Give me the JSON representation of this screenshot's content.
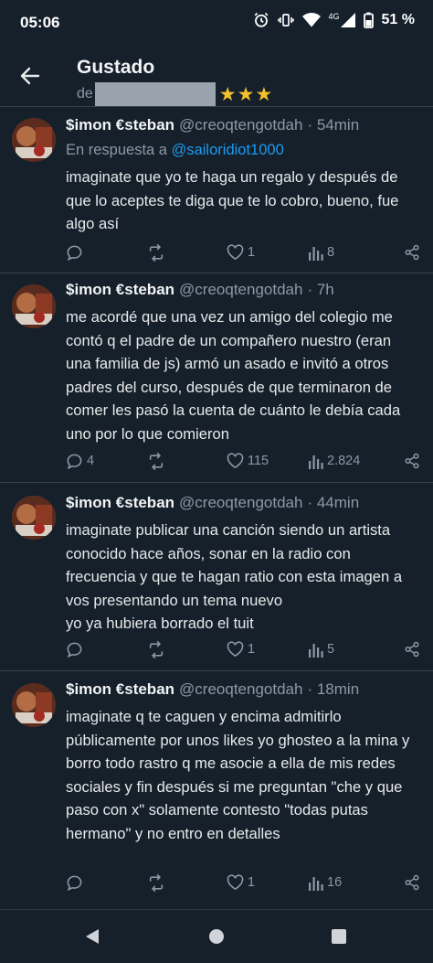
{
  "status": {
    "time": "05:06",
    "network": "4G",
    "battery": "51 %"
  },
  "header": {
    "title": "Gustado",
    "subtitle_prefix": "de",
    "stars": "★★★"
  },
  "tweets": [
    {
      "name": "$imon €steban",
      "handle": "@creoqtengotdah",
      "time": "· 54min",
      "reply_prefix": "En respuesta a",
      "reply_handle": "@sailoridiot1000",
      "text": "imaginate que yo te haga un regalo y después de que lo aceptes te diga que te lo cobro, bueno, fue algo así",
      "replies": "",
      "retweets": "",
      "likes": "1",
      "views": "8"
    },
    {
      "name": "$imon €steban",
      "handle": "@creoqtengotdah",
      "time": "· 7h",
      "text": "me acordé que una vez un amigo del colegio me contó q el padre de un compañero nuestro (eran una familia de js) armó un asado e invitó a otros padres del curso, después de que terminaron de comer les pasó la cuenta de cuánto le debía cada uno por lo que comieron",
      "replies": "4",
      "retweets": "",
      "likes": "115",
      "views": "2.824"
    },
    {
      "name": "$imon €steban",
      "handle": "@creoqtengotdah",
      "time": "· 44min",
      "text": "imaginate publicar una canción siendo un artista conocido hace años, sonar en la radio con frecuencia y que te hagan ratio con esta imagen a vos presentando un tema nuevo\nyo ya hubiera borrado el tuit",
      "replies": "",
      "retweets": "",
      "likes": "1",
      "views": "5"
    },
    {
      "name": "$imon €steban",
      "handle": "@creoqtengotdah",
      "time": "· 18min",
      "text": "imaginate q te caguen y encima admitirlo públicamente por unos likes yo ghosteo a la mina y borro todo rastro q me asocie a ella de mis redes sociales y fin después si me preguntan \"che y que paso con x\" solamente contesto \"todas putas hermano\" y no entro en detalles",
      "replies": "",
      "retweets": "",
      "likes": "1",
      "views": "16"
    }
  ],
  "colors": {
    "background": "#15202b",
    "link": "#1d9bf0",
    "muted": "#8b98a5",
    "divider": "#38444d",
    "stars": "#f4c02c"
  }
}
